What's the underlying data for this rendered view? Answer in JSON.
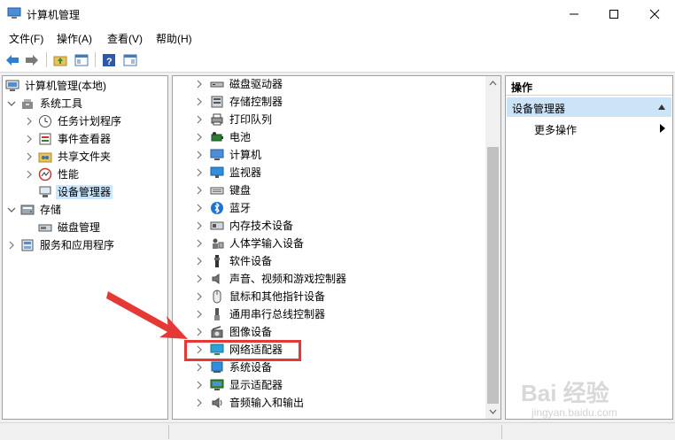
{
  "window": {
    "title": "计算机管理"
  },
  "menu": [
    "文件(F)",
    "操作(A)",
    "查看(V)",
    "帮助(H)"
  ],
  "left_tree": [
    {
      "label": "计算机管理(本地)",
      "icon": "computer-management-icon",
      "chev": "",
      "indent": 0
    },
    {
      "label": "系统工具",
      "icon": "tools-icon",
      "chev": "down",
      "indent": 1
    },
    {
      "label": "任务计划程序",
      "icon": "clock-icon",
      "chev": "right",
      "indent": 2
    },
    {
      "label": "事件查看器",
      "icon": "event-viewer-icon",
      "chev": "right",
      "indent": 2
    },
    {
      "label": "共享文件夹",
      "icon": "shared-folder-icon",
      "chev": "right",
      "indent": 2
    },
    {
      "label": "性能",
      "icon": "performance-icon",
      "chev": "right",
      "indent": 2
    },
    {
      "label": "设备管理器",
      "icon": "device-manager-icon",
      "chev": "",
      "indent": 2,
      "selected": true
    },
    {
      "label": "存储",
      "icon": "storage-icon",
      "chev": "down",
      "indent": 1
    },
    {
      "label": "磁盘管理",
      "icon": "disk-management-icon",
      "chev": "",
      "indent": 2
    },
    {
      "label": "服务和应用程序",
      "icon": "services-icon",
      "chev": "right",
      "indent": 1
    }
  ],
  "device_tree": [
    {
      "label": "磁盘驱动器",
      "icon": "disk-drive-icon"
    },
    {
      "label": "存储控制器",
      "icon": "storage-controller-icon"
    },
    {
      "label": "打印队列",
      "icon": "printer-icon"
    },
    {
      "label": "电池",
      "icon": "battery-icon"
    },
    {
      "label": "计算机",
      "icon": "computer-icon"
    },
    {
      "label": "监视器",
      "icon": "monitor-icon"
    },
    {
      "label": "键盘",
      "icon": "keyboard-icon"
    },
    {
      "label": "蓝牙",
      "icon": "bluetooth-icon"
    },
    {
      "label": "内存技术设备",
      "icon": "memory-device-icon"
    },
    {
      "label": "人体学输入设备",
      "icon": "hid-icon"
    },
    {
      "label": "软件设备",
      "icon": "software-device-icon"
    },
    {
      "label": "声音、视频和游戏控制器",
      "icon": "speaker-icon"
    },
    {
      "label": "鼠标和其他指针设备",
      "icon": "mouse-icon"
    },
    {
      "label": "通用串行总线控制器",
      "icon": "usb-icon"
    },
    {
      "label": "图像设备",
      "icon": "camera-icon"
    },
    {
      "label": "网络适配器",
      "icon": "network-adapter-icon"
    },
    {
      "label": "系统设备",
      "icon": "system-device-icon"
    },
    {
      "label": "显示适配器",
      "icon": "display-adapter-icon"
    },
    {
      "label": "音频输入和输出",
      "icon": "audio-io-icon"
    }
  ],
  "actions": {
    "header": "操作",
    "section": "设备管理器",
    "more": "更多操作"
  },
  "watermark": {
    "main": "Bai 经验",
    "sub": "jingyan.baidu.com"
  },
  "colors": {
    "accent": "#0078d7",
    "selection": "#cce8ff",
    "annotation": "#e53935"
  }
}
